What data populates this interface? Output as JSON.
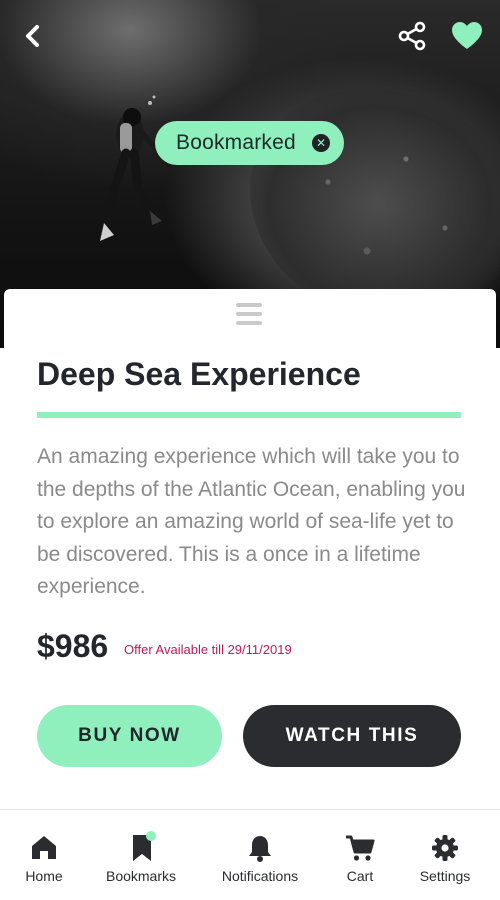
{
  "colors": {
    "accent": "#8ff0be",
    "dark": "#2b2c30",
    "title": "#23262b",
    "body_text": "#8a8a8a",
    "offer": "#c2185b"
  },
  "header": {
    "back_icon": "chevron-left-icon",
    "share_icon": "share-icon",
    "favorite_icon": "heart-icon"
  },
  "hero": {
    "image_subject": "scuba-diver-underwater-photo",
    "chip": {
      "label": "Bookmarked",
      "close_icon": "close-icon",
      "close_glyph": "✕"
    }
  },
  "detail": {
    "title": "Deep Sea Experience",
    "description": "An amazing experience which will take you to the depths of the Atlantic Ocean, enabling you to explore an amazing world of sea-life yet to be discovered. This is a once in a lifetime experience.",
    "price": "$986",
    "offer": "Offer Available till 29/11/2019"
  },
  "actions": {
    "buy_label": "BUY NOW",
    "watch_label": "WATCH THIS"
  },
  "nav": {
    "items": [
      {
        "label": "Home",
        "icon": "home-icon"
      },
      {
        "label": "Bookmarks",
        "icon": "bookmark-icon",
        "badge": true
      },
      {
        "label": "Notifications",
        "icon": "bell-icon"
      },
      {
        "label": "Cart",
        "icon": "cart-icon"
      },
      {
        "label": "Settings",
        "icon": "gear-icon"
      }
    ]
  }
}
